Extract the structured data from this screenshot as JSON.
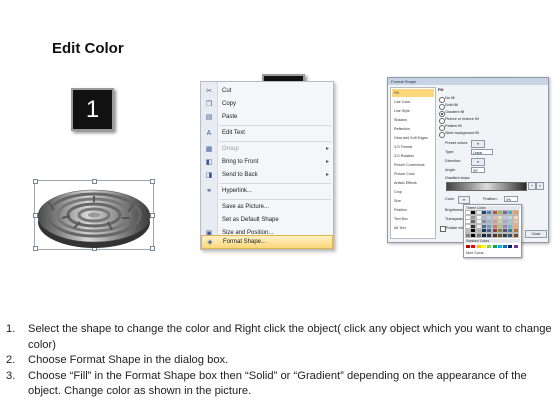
{
  "title": "Edit Color",
  "steps": [
    "1",
    "2",
    "3"
  ],
  "context_menu": {
    "items": [
      {
        "icon": "cut-icon",
        "glyph": "✂",
        "label": "Cut",
        "has_submenu": false,
        "disabled": false,
        "highlighted": false
      },
      {
        "icon": "copy-icon",
        "glyph": "❐",
        "label": "Copy",
        "has_submenu": false,
        "disabled": false,
        "highlighted": false
      },
      {
        "icon": "paste-icon",
        "glyph": "▤",
        "label": "Paste",
        "has_submenu": false,
        "disabled": false,
        "highlighted": false
      },
      {
        "icon": "edit-text-icon",
        "glyph": "A",
        "label": "Edit Text",
        "has_submenu": false,
        "disabled": false,
        "highlighted": false
      },
      {
        "icon": "group-icon",
        "glyph": "▦",
        "label": "Group",
        "has_submenu": true,
        "disabled": true,
        "highlighted": false
      },
      {
        "icon": "bring-to-front-icon",
        "glyph": "◧",
        "label": "Bring to Front",
        "has_submenu": true,
        "disabled": false,
        "highlighted": false
      },
      {
        "icon": "send-to-back-icon",
        "glyph": "◨",
        "label": "Send to Back",
        "has_submenu": true,
        "disabled": false,
        "highlighted": false
      },
      {
        "icon": "hyperlink-icon",
        "glyph": "⚭",
        "label": "Hyperlink...",
        "has_submenu": false,
        "disabled": false,
        "highlighted": false
      },
      {
        "icon": "save-picture-icon",
        "glyph": "",
        "label": "Save as Picture...",
        "has_submenu": false,
        "disabled": false,
        "highlighted": false
      },
      {
        "icon": "default-shape-icon",
        "glyph": "",
        "label": "Set as Default Shape",
        "has_submenu": false,
        "disabled": false,
        "highlighted": false
      },
      {
        "icon": "size-position-icon",
        "glyph": "▣",
        "label": "Size and Position...",
        "has_submenu": false,
        "disabled": false,
        "highlighted": false
      },
      {
        "icon": "format-shape-icon",
        "glyph": "◈",
        "label": "Format Shape...",
        "has_submenu": false,
        "disabled": false,
        "highlighted": true
      }
    ]
  },
  "format_dialog": {
    "title": "Format Shape",
    "nav": [
      "Fill",
      "Line Color",
      "Line Style",
      "Shadow",
      "Reflection",
      "Glow and Soft Edges",
      "3-D Format",
      "3-D Rotation",
      "Picture Corrections",
      "Picture Color",
      "Artistic Effects",
      "Crop",
      "Size",
      "Position",
      "Text Box",
      "Alt Text"
    ],
    "pane": {
      "heading": "Fill",
      "options": [
        "No fill",
        "Solid fill",
        "Gradient fill",
        "Picture or texture fill",
        "Pattern fill",
        "Slide background fill"
      ],
      "selected_option": "Gradient fill",
      "preset_colors": "Preset colors:",
      "type_label": "Type:",
      "type_value": "Linear",
      "direction_label": "Direction:",
      "angle_label": "Angle:",
      "angle_value": "90°",
      "gradient_stops": "Gradient stops",
      "color_label": "Color",
      "position_label": "Position:",
      "position_value": "0%",
      "brightness_label": "Brightness:",
      "transparency_label": "Transparency:",
      "rotate_label": "Rotate with shape"
    },
    "palette": {
      "theme_label": "Theme Colors",
      "standard_label": "Standard Colors",
      "more_label": "More Colors...",
      "theme_top": [
        "#ffffff",
        "#000000",
        "#eeece1",
        "#1f497d",
        "#4f81bd",
        "#c0504d",
        "#9bbb59",
        "#8064a2",
        "#4bacc6",
        "#f79646"
      ],
      "standard": [
        "#c00000",
        "#ff0000",
        "#ffc000",
        "#ffff00",
        "#92d050",
        "#00b050",
        "#00b0f0",
        "#0070c0",
        "#002060",
        "#7030a0"
      ]
    }
  },
  "instructions": [
    {
      "num": "1.",
      "text": "Select the shape to change the color and Right click the object( click any object which you want to change color)"
    },
    {
      "num": "2.",
      "text": "Choose Format Shape in the dialog box."
    },
    {
      "num": "3.",
      "text": "Choose “Fill” in the Format Shape box then “Solid” or “Gradient” depending on the appearance of the object. Change color as shown in the picture."
    }
  ]
}
